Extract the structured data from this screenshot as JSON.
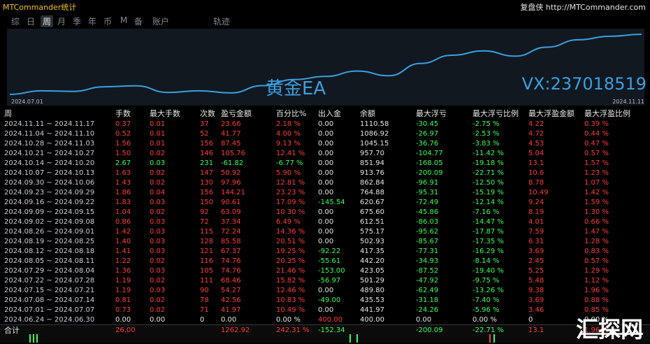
{
  "app": {
    "title": "MTCommander统计",
    "right_title": "复盘侠 http://MTCommander.com"
  },
  "tabs": {
    "items": [
      {
        "label": "综",
        "active": false
      },
      {
        "label": "日",
        "active": false
      },
      {
        "label": "周",
        "active": true
      },
      {
        "label": "月",
        "active": false
      },
      {
        "label": "季",
        "active": false
      },
      {
        "label": "年",
        "active": false
      },
      {
        "label": "币",
        "active": false
      },
      {
        "label": "M",
        "active": false
      },
      {
        "label": "备",
        "active": false
      },
      {
        "label": "账户",
        "active": false
      },
      {
        "label": "轨迹",
        "active": false
      }
    ]
  },
  "chart": {
    "overlay_left": "黄金EA",
    "overlay_right": "VX:237018519",
    "start_date": "2024.07.01",
    "end_date": "2024.11.11",
    "line_color": "#3aa0e0"
  },
  "chart_data": {
    "type": "line",
    "x": [
      "2024.06.24",
      "2024.07.01",
      "2024.07.08",
      "2024.07.15",
      "2024.07.22",
      "2024.07.29",
      "2024.08.05",
      "2024.08.12",
      "2024.08.19",
      "2024.08.26",
      "2024.09.02",
      "2024.09.09",
      "2024.09.16",
      "2024.09.23",
      "2024.09.30",
      "2024.10.07",
      "2024.10.14",
      "2024.10.21",
      "2024.10.28",
      "2024.11.04",
      "2024.11.11"
    ],
    "series": [
      {
        "values": [
          400.0,
          441.97,
          435.53,
          489.8,
          501.29,
          423.05,
          442.2,
          417.35,
          502.93,
          575.17,
          612.51,
          675.6,
          620.67,
          764.88,
          862.84,
          913.76,
          851.94,
          957.7,
          1045.15,
          1086.92,
          1110.58
        ]
      }
    ]
  },
  "table": {
    "headers": [
      "周",
      "手数",
      "最大手数",
      "次数",
      "盈亏金额",
      "百分比%",
      "出入金",
      "余额",
      "最大浮亏",
      "最大浮亏比例",
      "最大浮盈金额",
      "最大浮盈比例"
    ],
    "rows": [
      [
        "2024.11.11 ~ 2024.11.17",
        "0.37",
        "0.01",
        "37",
        "23.66",
        "2.18 %",
        "0.00",
        "1110.58",
        "-30.45",
        "-2.75 %",
        "4.22",
        "0.39 %"
      ],
      [
        "2024.11.04 ~ 2024.11.10",
        "0.52",
        "0.01",
        "52",
        "41.77",
        "4.00 %",
        "0.00",
        "1086.92",
        "-26.97",
        "-2.53 %",
        "4.72",
        "0.44 %"
      ],
      [
        "2024.10.28 ~ 2024.11.03",
        "1.56",
        "0.01",
        "156",
        "87.45",
        "9.13 %",
        "0.00",
        "1045.15",
        "-36.76",
        "-3.83 %",
        "4.53",
        "0.47 %"
      ],
      [
        "2024.10.21 ~ 2024.10.27",
        "1.50",
        "0.02",
        "146",
        "105.76",
        "12.41 %",
        "0.00",
        "957.70",
        "-104.77",
        "-11.42 %",
        "5.04",
        "0.57 %"
      ],
      [
        "2024.10.14 ~ 2024.10.20",
        "2.67",
        "0.03",
        "231",
        "-61.82",
        "-6.77 %",
        "0.00",
        "851.94",
        "-168.05",
        "-19.18 %",
        "13.1",
        "1.57 %"
      ],
      [
        "2024.10.07 ~ 2024.10.13",
        "1.63",
        "0.02",
        "147",
        "50.92",
        "5.90 %",
        "0.00",
        "913.76",
        "-200.09",
        "-22.71 %",
        "10.6",
        "1.23 %"
      ],
      [
        "2024.09.30 ~ 2024.10.06",
        "1.43",
        "0.02",
        "130",
        "97.96",
        "12.81 %",
        "0.00",
        "862.84",
        "-96.91",
        "-12.50 %",
        "8.78",
        "1.07 %"
      ],
      [
        "2024.09.23 ~ 2024.09.29",
        "1.86",
        "0.04",
        "156",
        "144.21",
        "23.23 %",
        "0.00",
        "764.88",
        "-95.31",
        "-15.19 %",
        "10.49",
        "1.42 %"
      ],
      [
        "2024.09.16 ~ 2024.09.22",
        "1.83",
        "0.03",
        "150",
        "90.61",
        "17.09 %",
        "-145.54",
        "620.67",
        "-72.49",
        "-12.14 %",
        "9.24",
        "1.59 %"
      ],
      [
        "2024.09.09 ~ 2024.09.15",
        "1.04",
        "0.02",
        "92",
        "63.09",
        "10.30 %",
        "0.00",
        "675.60",
        "-45.86",
        "-7.16 %",
        "8.19",
        "1.30 %"
      ],
      [
        "2024.09.02 ~ 2024.09.08",
        "0.86",
        "0.03",
        "72",
        "37.34",
        "6.49 %",
        "0.00",
        "612.51",
        "-86.03",
        "-14.47 %",
        "4.01",
        "0.66 %"
      ],
      [
        "2024.08.26 ~ 2024.09.01",
        "1.42",
        "0.03",
        "115",
        "72.24",
        "14.36 %",
        "0.00",
        "575.17",
        "-95.62",
        "-17.87 %",
        "7.59",
        "1.47 %"
      ],
      [
        "2024.08.19 ~ 2024.08.25",
        "1.40",
        "0.03",
        "128",
        "85.58",
        "20.51 %",
        "0.00",
        "502.93",
        "-85.67",
        "-17.35 %",
        "6.31",
        "1.28 %"
      ],
      [
        "2024.08.12 ~ 2024.08.18",
        "1.41",
        "0.03",
        "121",
        "67.37",
        "19.25 %",
        "-92.22",
        "417.35",
        "-77.31",
        "-16.29 %",
        "3.69",
        "0.83 %"
      ],
      [
        "2024.08.05 ~ 2024.08.11",
        "1.22",
        "0.02",
        "116",
        "74.76",
        "20.35 %",
        "-55.61",
        "442.20",
        "-34.93",
        "-8.14 %",
        "2.45",
        "0.57 %"
      ],
      [
        "2024.07.29 ~ 2024.08.04",
        "1.36",
        "0.03",
        "105",
        "74.76",
        "21.46 %",
        "-153.00",
        "423.05",
        "-87.52",
        "-19.40 %",
        "5.25",
        "1.29 %"
      ],
      [
        "2024.07.22 ~ 2024.07.28",
        "1.19",
        "0.02",
        "111",
        "68.46",
        "15.82 %",
        "-56.97",
        "501.29",
        "-47.92",
        "-9.75 %",
        "5.48",
        "1.12 %"
      ],
      [
        "2024.07.15 ~ 2024.07.21",
        "1.19",
        "0.03",
        "90",
        "54.27",
        "12.46 %",
        "0.00",
        "489.80",
        "-62.49",
        "-13.26 %",
        "9.38",
        "1.96 %"
      ],
      [
        "2024.07.08 ~ 2024.07.14",
        "0.81",
        "0.02",
        "78",
        "42.56",
        "10.83 %",
        "-49.00",
        "435.53",
        "-31.18",
        "-7.40 %",
        "3.69",
        "0.88 %"
      ],
      [
        "2024.07.01 ~ 2024.07.07",
        "0.73",
        "0.02",
        "71",
        "41.97",
        "10.49 %",
        "0.00",
        "441.97",
        "-24.26",
        "-5.96 %",
        "3.46",
        "0.85 %"
      ],
      [
        "2024.06.24 ~ 2024.06.30",
        "0.00",
        "0.00",
        "0",
        "0.00",
        "0.00 %",
        "400.00",
        "400.00",
        "0.00",
        "0.00 %",
        "0",
        "0.00 %"
      ]
    ],
    "total": [
      "合计",
      "26.00",
      "",
      "",
      "1262.92",
      "242.31 %",
      "-152.34",
      "",
      "-200.09",
      "-22.71 %",
      "13.1",
      "1.96 %"
    ]
  },
  "watermark": {
    "text": "汇探网"
  }
}
